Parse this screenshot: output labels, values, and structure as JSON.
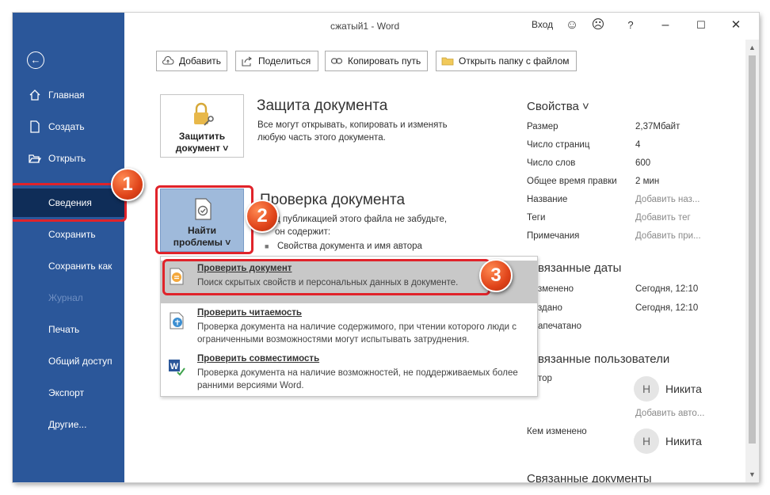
{
  "window": {
    "title": "сжатый1  -  Word",
    "signin": "Вход",
    "help": "?"
  },
  "sidebar": {
    "items": [
      {
        "label": "Главная",
        "icon": "home-icon"
      },
      {
        "label": "Создать",
        "icon": "new-document-icon"
      },
      {
        "label": "Открыть",
        "icon": "folder-open-icon"
      },
      {
        "label": "Сведения"
      },
      {
        "label": "Сохранить"
      },
      {
        "label": "Сохранить как"
      },
      {
        "label": "Журнал",
        "disabled": true
      },
      {
        "label": "Печать"
      },
      {
        "label": "Общий доступ"
      },
      {
        "label": "Экспорт"
      },
      {
        "label": "Другие..."
      }
    ]
  },
  "toolbar": {
    "add": "Добавить",
    "share": "Поделиться",
    "copy_path": "Копировать путь",
    "open_folder": "Открыть папку с файлом"
  },
  "protect": {
    "button_line1": "Защитить",
    "button_line2": "документ ˅",
    "title": "Защита документа",
    "text": "Все могут открывать, копировать и изменять любую часть этого документа."
  },
  "inspect": {
    "button_line1": "Найти",
    "button_line2": "проблемы ˅",
    "title": "Проверка документа",
    "text_line1": "д публикацией этого файла не забудьте,",
    "text_line2": "он содержит:",
    "bullet": "Свойства документа и имя автора"
  },
  "dropdown": {
    "items": [
      {
        "title": "Проверить документ",
        "desc": "Поиск скрытых свойств и персональных данных в документе."
      },
      {
        "title": "Проверить читаемость",
        "desc": "Проверка документа на наличие содержимого, при чтении которого люди с ограниченными возможностями могут испытывать затруднения."
      },
      {
        "title": "Проверить совместимость",
        "desc": "Проверка документа на наличие возможностей, не поддерживаемых более ранними версиями Word."
      }
    ]
  },
  "properties": {
    "heading": "Свойства ˅",
    "rows": [
      {
        "label": "Размер",
        "value": "2,37Мбайт"
      },
      {
        "label": "Число страниц",
        "value": "4"
      },
      {
        "label": "Число слов",
        "value": "600"
      },
      {
        "label": "Общее время правки",
        "value": "2 мин"
      },
      {
        "label": "Название",
        "value": "Добавить наз..."
      },
      {
        "label": "Теги",
        "value": "Добавить тег"
      },
      {
        "label": "Примечания",
        "value": "Добавить при..."
      }
    ],
    "dates_heading": "вязанные даты",
    "dates": [
      {
        "label": "зменено",
        "value": "Сегодня, 12:10"
      },
      {
        "label": "здано",
        "value": "Сегодня, 12:10"
      },
      {
        "label": "апечатано",
        "value": ""
      }
    ],
    "people_heading": "вязанные пользователи",
    "author_label": "тор",
    "author_initial": "Н",
    "author_name": "Никита",
    "add_author": "Добавить авто...",
    "modified_by_label": "Кем изменено",
    "modified_initial": "Н",
    "modified_name": "Никита",
    "docs_heading": "Связанные документы"
  },
  "annotations": {
    "step1": "1",
    "step2": "2",
    "step3": "3",
    "color": "#e0232a"
  },
  "colors": {
    "sidebar": "#2b579a",
    "sidebar_active": "#0f2d58",
    "selected_button": "#9fbadb"
  }
}
